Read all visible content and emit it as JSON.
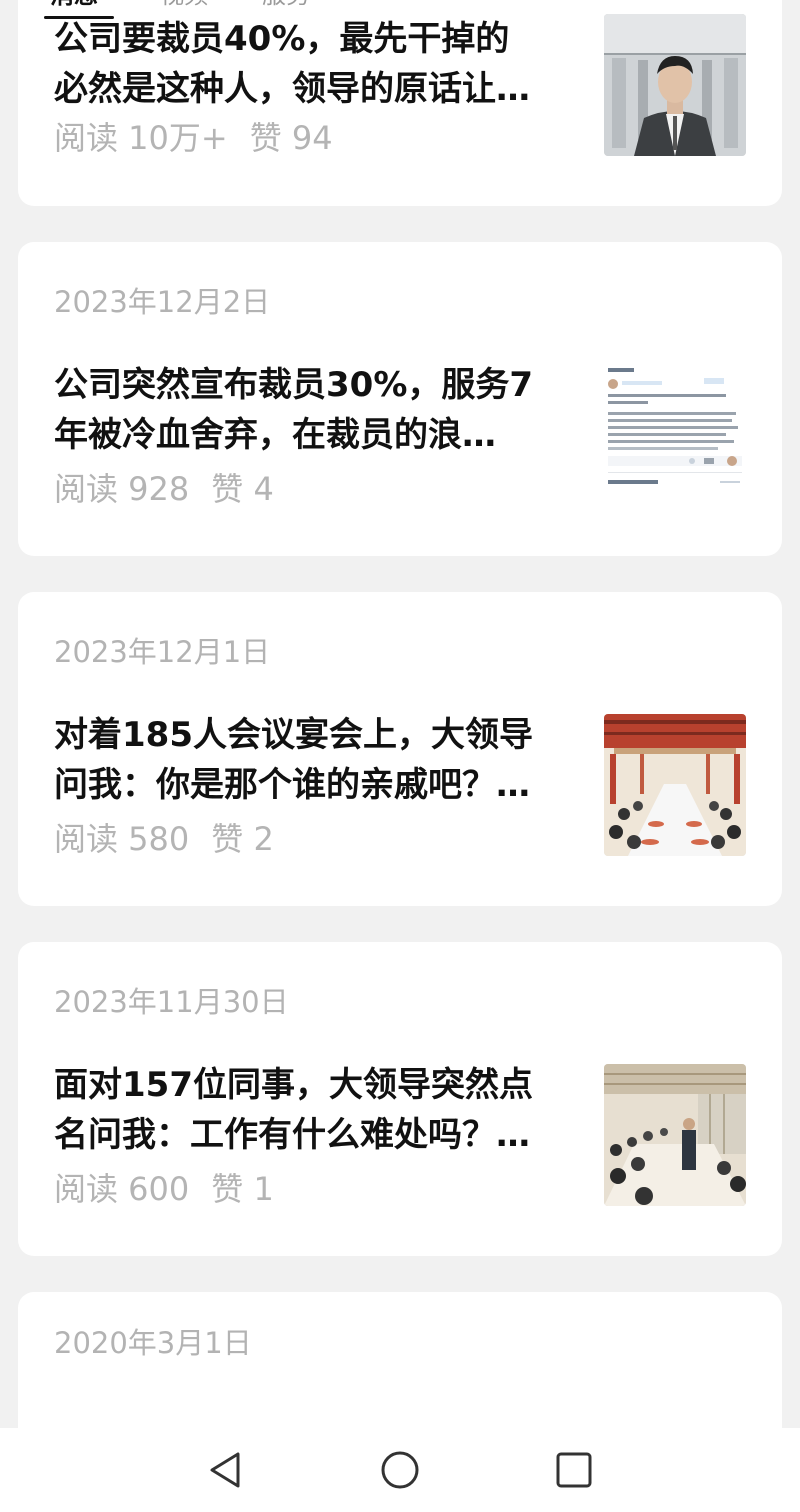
{
  "tabs": [
    {
      "label": "消息",
      "active": true
    },
    {
      "label": "视频",
      "active": false
    },
    {
      "label": "服务",
      "active": false
    }
  ],
  "articles": [
    {
      "date": "",
      "title_lines": [
        "公司要裁员40%，最先干掉的",
        "必然是这种人，领导的原话让…"
      ],
      "reads": "阅读 10万+",
      "likes": "赞 94",
      "thumb_icon": "businessman-illustration"
    },
    {
      "date": "2023年12月2日",
      "title_lines": [
        "公司突然宣布裁员30%，服务7",
        "年被冷血舍弃，在裁员的浪…"
      ],
      "reads": "阅读 928",
      "likes": "赞 4",
      "thumb_icon": "chat-screenshot"
    },
    {
      "date": "2023年12月1日",
      "title_lines": [
        "对着185人会议宴会上，大领导",
        "问我：你是那个谁的亲戚吧？…"
      ],
      "reads": "阅读 580",
      "likes": "赞 2",
      "thumb_icon": "banquet-hall"
    },
    {
      "date": "2023年11月30日",
      "title_lines": [
        "面对157位同事，大领导突然点",
        "名问我：工作有什么难处吗？…"
      ],
      "reads": "阅读 600",
      "likes": "赞 1",
      "thumb_icon": "meeting-room"
    },
    {
      "date": "2020年3月1日"
    }
  ],
  "system_nav": {
    "back_icon": "triangle-back-icon",
    "home_icon": "circle-home-icon",
    "recents_icon": "square-recents-icon"
  }
}
